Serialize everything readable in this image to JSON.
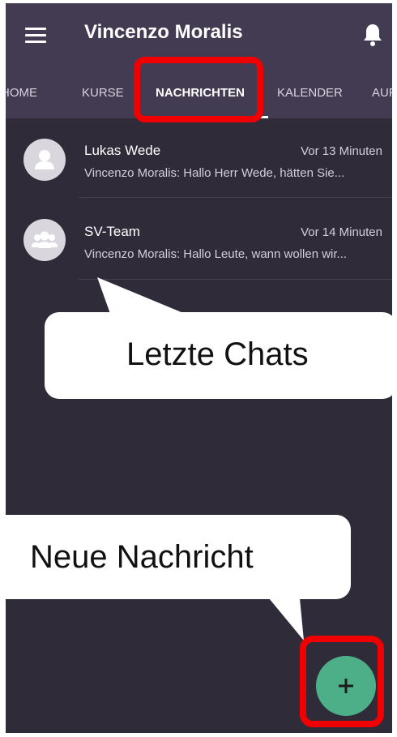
{
  "header": {
    "title": "Vincenzo Moralis",
    "menu_icon": "hamburger-menu-icon",
    "notification_icon": "bell-icon"
  },
  "tabs": [
    {
      "label": "HOME",
      "active": false
    },
    {
      "label": "KURSE",
      "active": false
    },
    {
      "label": "NACHRICHTEN",
      "active": true
    },
    {
      "label": "KALENDER",
      "active": false
    },
    {
      "label": "AUF",
      "active": false
    }
  ],
  "chats": [
    {
      "name": "Lukas Wede",
      "time": "Vor 13 Minuten",
      "preview": "Vincenzo Moralis: Hallo Herr Wede, hätten Sie...",
      "avatar_icon": "person-icon"
    },
    {
      "name": "SV-Team",
      "time": "Vor 14 Minuten",
      "preview": "Vincenzo Moralis: Hallo Leute, wann wollen wir...",
      "avatar_icon": "group-icon"
    }
  ],
  "callouts": {
    "recent_chats": "Letzte Chats",
    "new_message": "Neue Nachricht"
  },
  "fab": {
    "icon": "plus-icon"
  },
  "colors": {
    "background": "#2f2b38",
    "appbar": "#433b52",
    "fab": "#4caf87",
    "highlight": "#f00000"
  }
}
